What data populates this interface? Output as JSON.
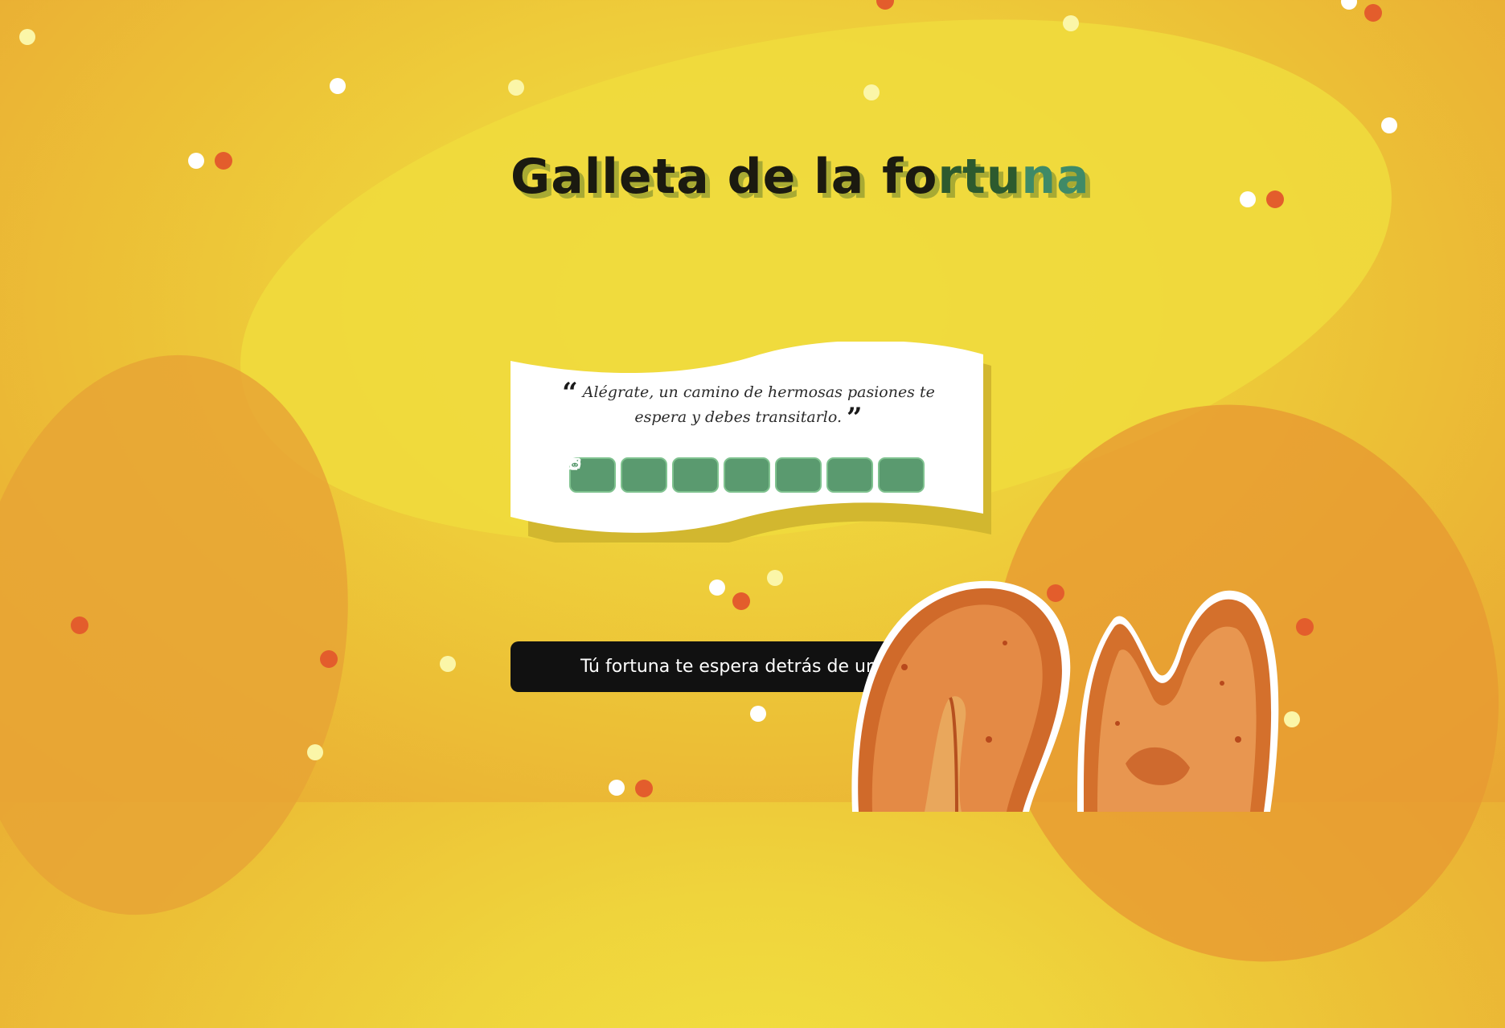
{
  "header": {
    "title_part1": "Galleta de la fo",
    "title_part2": "rtu",
    "title_part3": "na"
  },
  "fortune": {
    "open_quote": "“",
    "text": "Alégrate, un camino de hermosas pasiones te espera y debes transitarlo.",
    "close_quote": "”"
  },
  "share_buttons": [
    {
      "icon": "copy-icon"
    },
    {
      "icon": "twitter-icon"
    },
    {
      "icon": "whatsapp-icon"
    },
    {
      "icon": "facebook-icon"
    },
    {
      "icon": "telegram-icon"
    },
    {
      "icon": "linkedin-icon"
    },
    {
      "icon": "reddit-icon"
    }
  ],
  "cta": {
    "label": "Tú fortuna te espera detrás de un click"
  },
  "colors": {
    "background": "#efd43c",
    "share_button": "#5a9a6f",
    "cta_background": "#111111",
    "confetti_red": "#e35d2c"
  }
}
